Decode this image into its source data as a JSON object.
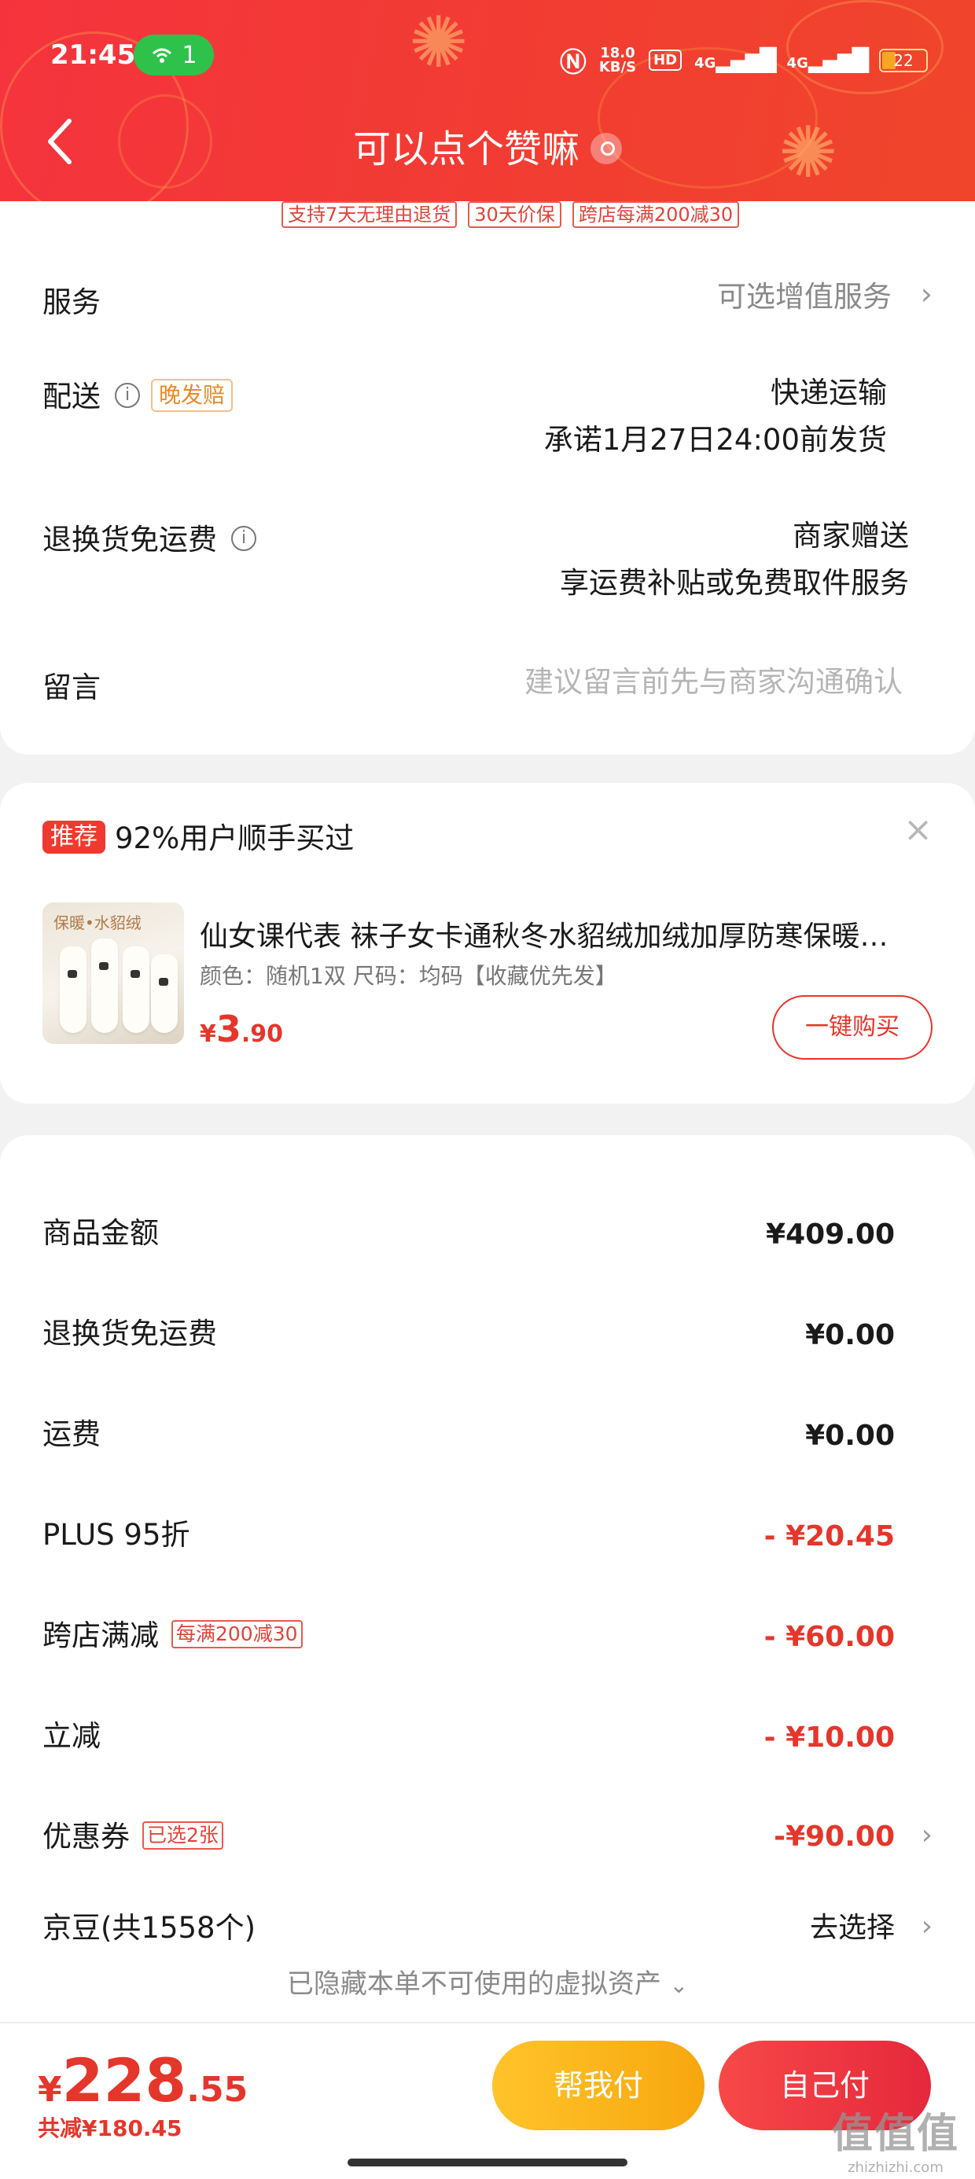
{
  "status_bar": {
    "time": "21:45",
    "hotspot_count": "1",
    "net_speed_value": "18.0",
    "net_speed_unit": "KB/S",
    "hd_label": "HD",
    "signal1_label": "4G",
    "signal2_label": "4G",
    "battery": "22"
  },
  "header": {
    "title": "可以点个赞嘛"
  },
  "service_tags": [
    "支持7天无理由退货",
    "30天价保",
    "跨店每满200减30"
  ],
  "order_info": {
    "service": {
      "label": "服务",
      "value": "可选增值服务"
    },
    "delivery": {
      "label": "配送",
      "tag": "晚发赔",
      "value_line1": "快递运输",
      "value_line2": "承诺1月27日24:00前发货"
    },
    "return_shipping": {
      "label": "退换货免运费",
      "value_line1": "商家赠送",
      "value_line2": "享运费补贴或免费取件服务"
    },
    "message": {
      "label": "留言",
      "placeholder": "建议留言前先与商家沟通确认"
    }
  },
  "recommendation": {
    "badge": "推荐",
    "text": "92%用户顺手买过",
    "close_symbol": "×",
    "product": {
      "image_brand": "保暖•水貂绒",
      "title": "仙女课代表 袜子女卡通秋冬水貂绒加绒加厚防寒保暖…",
      "spec": "颜色：随机1双   尺码：均码【收藏优先发】",
      "price_symbol": "¥",
      "price_int": "3",
      "price_dec": ".90",
      "buy_label": "一键购买"
    }
  },
  "price_summary": {
    "goods_amount": {
      "label": "商品金额",
      "value": "¥409.00"
    },
    "return_fee": {
      "label": "退换货免运费",
      "value": "¥0.00"
    },
    "shipping": {
      "label": "运费",
      "value": "¥0.00"
    },
    "plus_discount": {
      "label": "PLUS 95折",
      "value": "- ¥20.45"
    },
    "cross_store": {
      "label": "跨店满减",
      "tag": "每满200减30",
      "value": "- ¥60.00"
    },
    "instant_off": {
      "label": "立减",
      "value": "- ¥10.00"
    },
    "coupon": {
      "label": "优惠券",
      "tag": "已选2张",
      "value": "-¥90.00"
    },
    "jd_beans": {
      "label": "京豆(共1558个)",
      "value": "去选择"
    },
    "hidden_assets": "已隐藏本单不可使用的虚拟资产"
  },
  "bottom_bar": {
    "total_symbol": "¥",
    "total_int": "228",
    "total_dec": ".55",
    "saved": "共减¥180.45",
    "help_pay": "帮我付",
    "self_pay": "自己付"
  },
  "watermark": {
    "big": "值值值",
    "small": "zhizhizhi.com"
  },
  "colors": {
    "header_red": "#f23b34",
    "price_red": "#e5362b",
    "help_button_yellow": "#f7a70e",
    "self_pay_red": "#e5283c",
    "recommend_badge": "#f03a2f",
    "tag_orange": "#e88a2a"
  },
  "icons": [
    "back-arrow-icon",
    "location-icon",
    "info-icon",
    "chevron-right-icon",
    "close-icon",
    "chevron-down-icon",
    "hotspot-icon",
    "nfc-icon",
    "signal-icon",
    "battery-icon"
  ]
}
